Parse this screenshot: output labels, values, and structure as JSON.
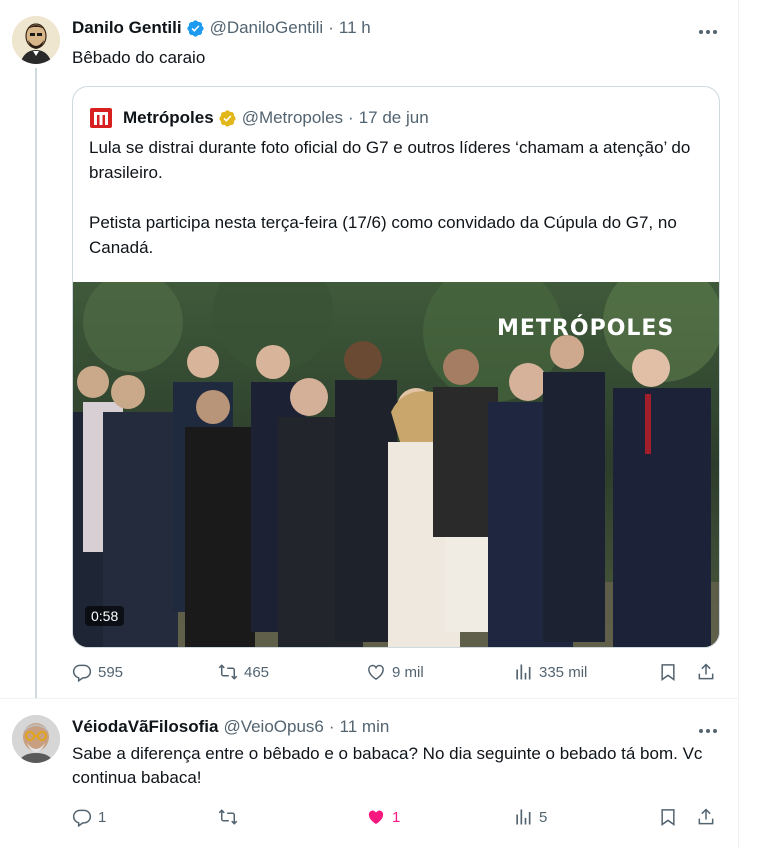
{
  "tweet1": {
    "name": "Danilo Gentili",
    "handle": "@DaniloGentili",
    "time": "11 h",
    "text": "Bêbado do caraio",
    "quote": {
      "name": "Metrópoles",
      "handle": "@Metropoles",
      "time": "17 de jun",
      "text_p1": "Lula se distrai durante foto oficial do G7 e outros líderes ‘chamam a atenção’ do brasileiro.",
      "text_p2": "Petista participa nesta terça-feira (17/6) como convidado da Cúpula do G7, no Canadá.",
      "video_watermark": "METRÓPOLES",
      "video_duration": "0:58"
    },
    "actions": {
      "replies": "595",
      "reposts": "465",
      "likes": "9 mil",
      "views": "335 mil"
    }
  },
  "tweet2": {
    "name": "VéiodaVãFilosofia",
    "handle": "@VeioOpus6",
    "time": "11 min",
    "text": "Sabe a diferença entre o bêbado e o babaca? No dia seguinte o bebado tá bom.  Vc continua babaca!",
    "actions": {
      "replies": "1",
      "reposts": "",
      "likes": "1",
      "views": "5"
    }
  },
  "colors": {
    "verified": "#1d9bf0",
    "verified_org": "#e2b719",
    "secondary_text": "#536471",
    "like_active": "#f91880",
    "brand_metropoles": "#d92020"
  },
  "icons": [
    "more-icon",
    "reply-icon",
    "repost-icon",
    "like-icon",
    "views-icon",
    "bookmark-icon",
    "share-icon",
    "verified-icon"
  ]
}
